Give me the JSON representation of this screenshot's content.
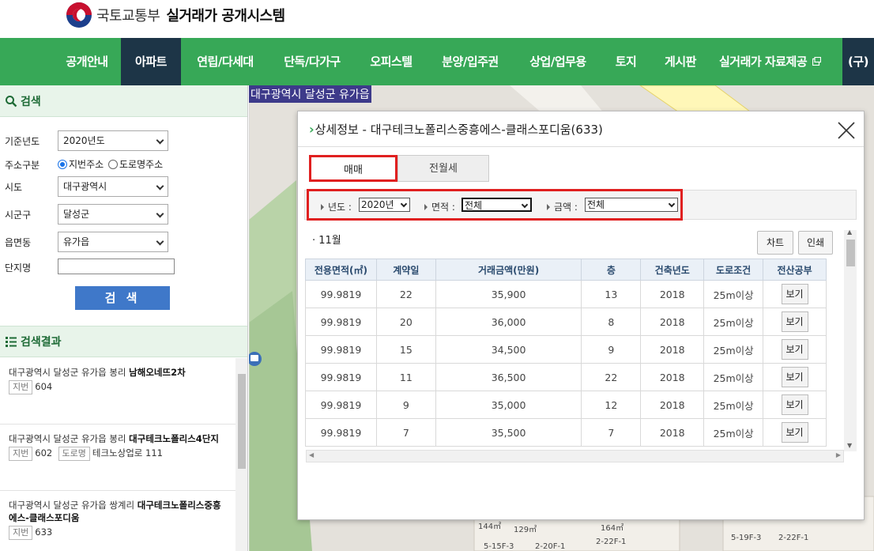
{
  "header": {
    "ministry": "국토교통부",
    "system": "실거래가 공개시스템"
  },
  "nav": {
    "items": [
      "공개안내",
      "아파트",
      "연립/다세대",
      "단독/다가구",
      "오피스텔",
      "분양/입주권",
      "상업/업무용",
      "토지",
      "게시판",
      "실거래가 자료제공",
      "(구)"
    ],
    "active_index": 1
  },
  "sidebar": {
    "search_title": "검색",
    "fields": {
      "year_label": "기준년도",
      "year_value": "2020년도",
      "address_type_label": "주소구분",
      "address_lot": "지번주소",
      "address_road": "도로명주소",
      "address_selected": "지번주소",
      "sido_label": "시도",
      "sido_value": "대구광역시",
      "sigungu_label": "시군구",
      "sigungu_value": "달성군",
      "dong_label": "읍면동",
      "dong_value": "유가읍",
      "complex_label": "단지명",
      "complex_value": ""
    },
    "search_button": "검 색",
    "results_title": "검색결과",
    "results": [
      {
        "addr": "대구광역시 달성군 유가읍 봉리",
        "name": "남해오네뜨2차",
        "tag1": "지번",
        "num1": "604",
        "tag2": "",
        "num2": ""
      },
      {
        "addr": "대구광역시 달성군 유가읍 봉리",
        "name": "대구테크노폴리스4단지",
        "tag1": "지번",
        "num1": "602",
        "tag2": "도로명",
        "num2": "테크노상업로 111"
      },
      {
        "addr": "대구광역시 달성군 유가읍 쌍계리",
        "name": "대구테크노폴리스중흥에스-클래스포디움",
        "tag1": "지번",
        "num1": "633",
        "tag2": "",
        "num2": ""
      }
    ]
  },
  "map": {
    "location_label": "대구광역시 달성군 유가읍",
    "labels": [
      "144㎡",
      "129㎡",
      "164㎡",
      "5-15F-3",
      "2-20F-1",
      "2-22F-1",
      "5-19F-3",
      "2-22F-1"
    ]
  },
  "modal": {
    "title": "상세정보 - 대구테크노폴리스중흥에스-클래스포디움(633)",
    "tabs": [
      "매매",
      "전월세"
    ],
    "active_tab": "매매",
    "filters": {
      "year_label": "년도 :",
      "year_value": "2020년",
      "area_label": "면적 :",
      "area_value": "전체",
      "price_label": "금액 :",
      "price_value": "전체"
    },
    "month": "· 11월",
    "chart_button": "차트",
    "print_button": "인쇄",
    "columns": [
      "전용면적(㎡)",
      "계약일",
      "거래금액(만원)",
      "층",
      "건축년도",
      "도로조건",
      "전산공부"
    ],
    "rows": [
      [
        "99.9819",
        "22",
        "35,900",
        "13",
        "2018",
        "25m이상",
        "보기"
      ],
      [
        "99.9819",
        "20",
        "36,000",
        "8",
        "2018",
        "25m이상",
        "보기"
      ],
      [
        "99.9819",
        "15",
        "34,500",
        "9",
        "2018",
        "25m이상",
        "보기"
      ],
      [
        "99.9819",
        "11",
        "36,500",
        "22",
        "2018",
        "25m이상",
        "보기"
      ],
      [
        "99.9819",
        "9",
        "35,000",
        "12",
        "2018",
        "25m이상",
        "보기"
      ],
      [
        "99.9819",
        "7",
        "35,500",
        "7",
        "2018",
        "25m이상",
        "보기"
      ]
    ]
  },
  "colors": {
    "nav_green": "#37a857",
    "nav_active": "#1d3547",
    "highlight_red": "#e02020",
    "search_blue": "#3f78c9"
  }
}
